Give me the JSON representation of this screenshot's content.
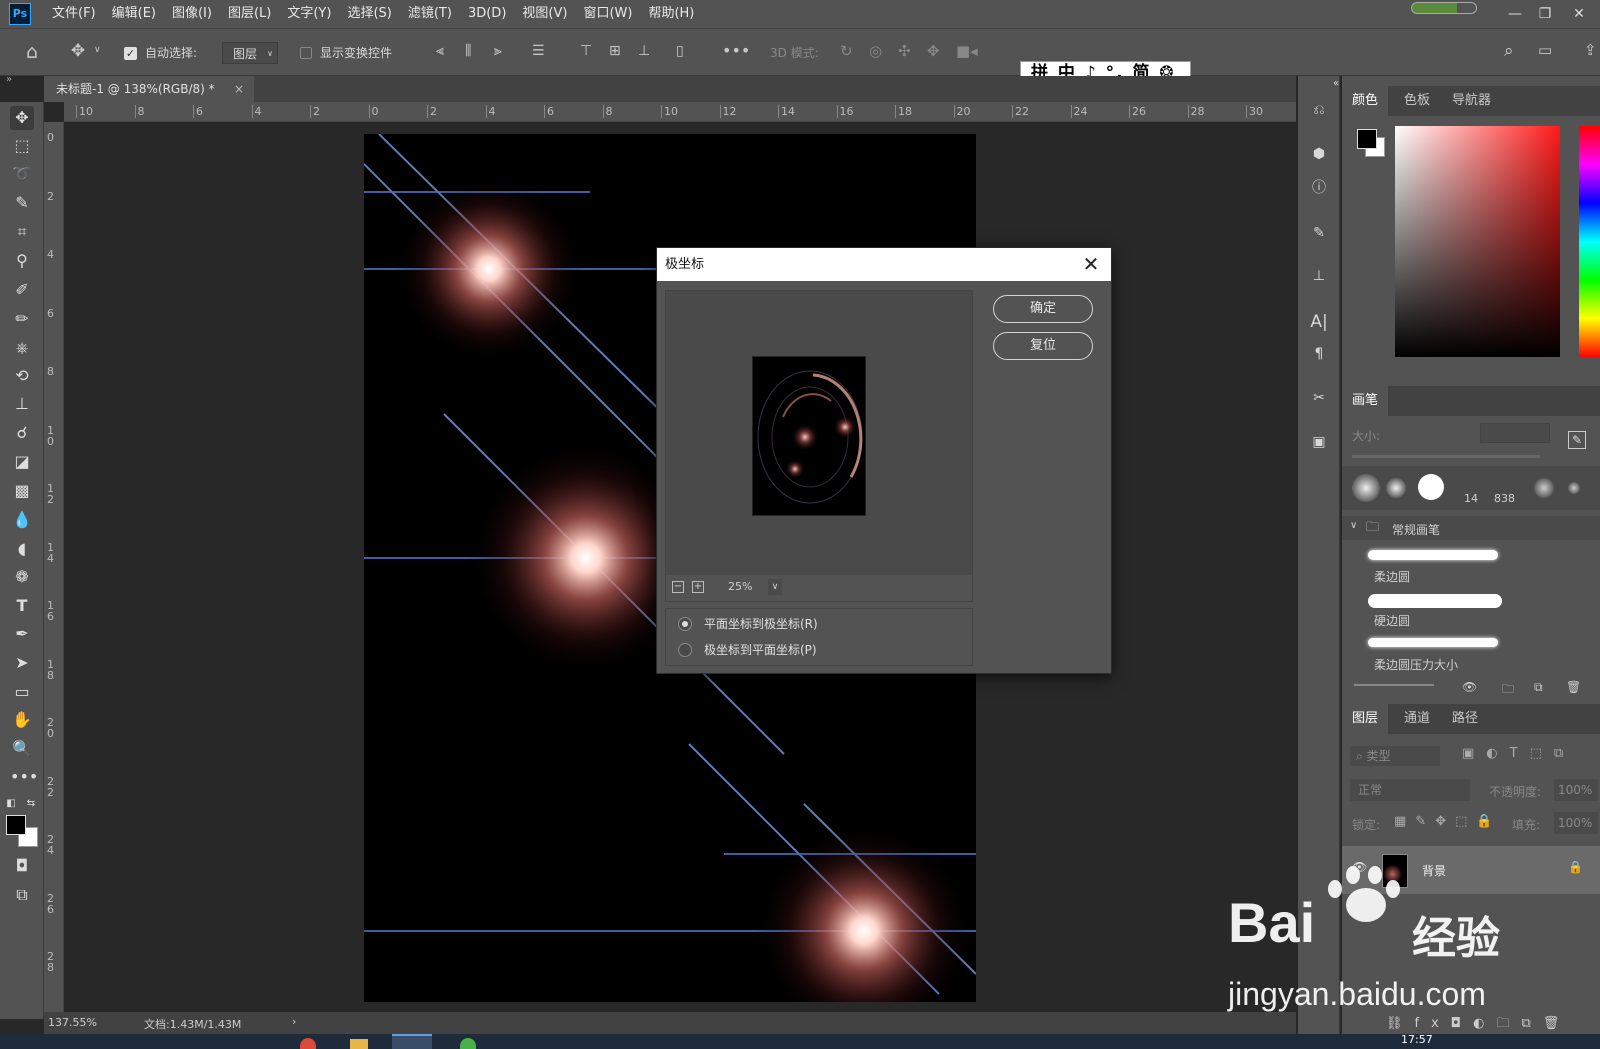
{
  "app": {
    "logo": "Ps"
  },
  "menu": [
    "文件(F)",
    "编辑(E)",
    "图像(I)",
    "图层(L)",
    "文字(Y)",
    "选择(S)",
    "滤镜(T)",
    "3D(D)",
    "视图(V)",
    "窗口(W)",
    "帮助(H)"
  ],
  "options": {
    "auto_select": "自动选择:",
    "auto_select_target": "图层",
    "show_transform": "显示变换控件",
    "mode_3d": "3D 模式:"
  },
  "ime": "拼 中 ♪ °, 简 ❂ ⋮",
  "document": {
    "tab": "未标题-1 @ 138%(RGB/8) *",
    "close": "×"
  },
  "ruler_h": [
    "10",
    "8",
    "6",
    "4",
    "2",
    "0",
    "2",
    "4",
    "6",
    "8",
    "10",
    "12",
    "14",
    "16",
    "18",
    "20",
    "22",
    "24",
    "26",
    "28",
    "30"
  ],
  "ruler_v": [
    "0",
    "2",
    "4",
    "6",
    "8",
    "1\n0",
    "1\n2",
    "1\n4",
    "1\n6",
    "1\n8",
    "2\n0",
    "2\n2",
    "2\n4",
    "2\n6",
    "2\n8"
  ],
  "status": {
    "zoom": "137.55%",
    "doc": "文档:1.43M/1.43M",
    "arrow": "›"
  },
  "taskbar": {
    "time": "17:57"
  },
  "dialog": {
    "title": "极坐标",
    "ok": "确定",
    "reset": "复位",
    "zoom": "25%",
    "options": [
      "平面坐标到极坐标(R)",
      "极坐标到平面坐标(P)"
    ],
    "selected": 0
  },
  "panels": {
    "color_tabs": [
      "颜色",
      "色板",
      "导航器"
    ],
    "brush_tab": "画笔",
    "brush_size_label": "大小:",
    "brush_presets": [
      "14",
      "838"
    ],
    "brush_group": "常规画笔",
    "brushes": [
      "柔边圆",
      "硬边圆",
      "柔边圆压力大小"
    ],
    "layers_tabs": [
      "图层",
      "通道",
      "路径"
    ],
    "layers_filter": "类型",
    "blend_mode": "正常",
    "opacity_label": "不透明度:",
    "opacity": "100%",
    "lock_label": "锁定:",
    "fill_label": "填充:",
    "fill": "100%",
    "layer_name": "背景"
  },
  "watermark": {
    "brand": "Bai",
    "brand2": "经验",
    "url": "jingyan.baidu.com"
  }
}
